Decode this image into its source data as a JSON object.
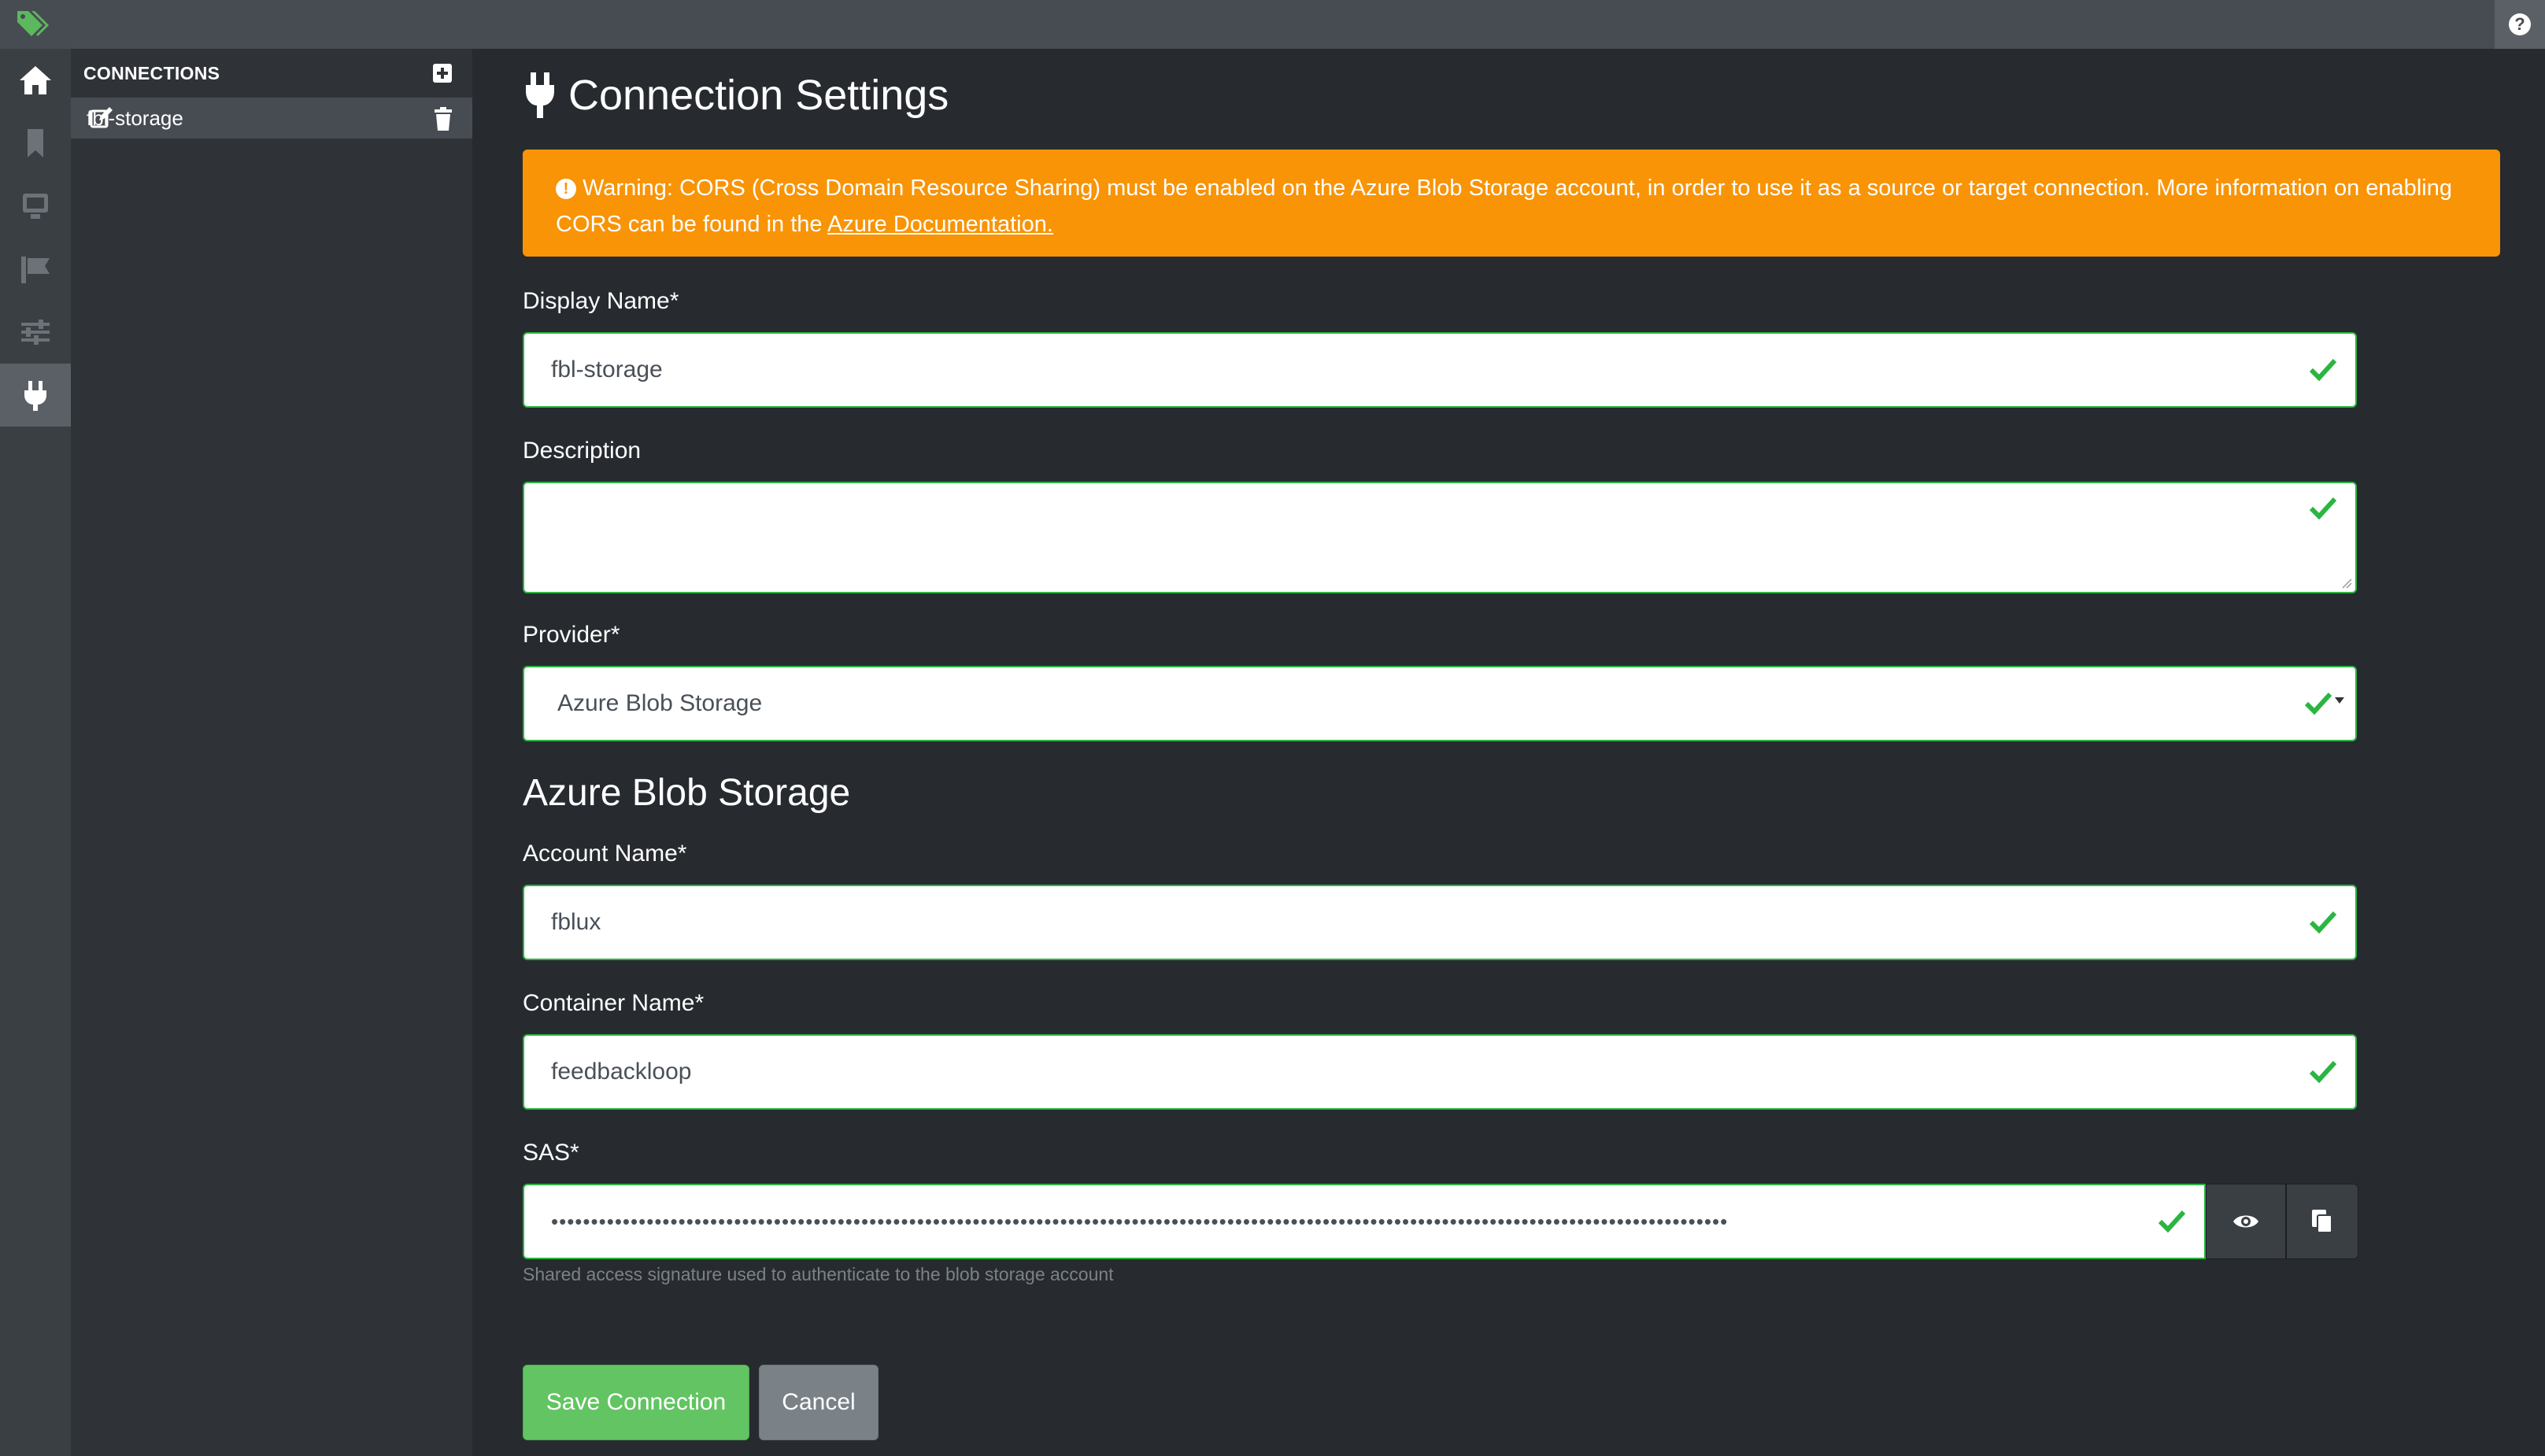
{
  "topbar": {
    "help_label": "?"
  },
  "sidebar": {
    "rail": [
      "home-icon",
      "bookmark-icon",
      "monitor-icon",
      "flag-icon",
      "sliders-icon",
      "plug-icon"
    ],
    "active": "plug-icon"
  },
  "connections": {
    "title": "CONNECTIONS",
    "items": [
      {
        "label": "fbl-storage"
      }
    ]
  },
  "page": {
    "title": "Connection Settings",
    "warning": {
      "text": "Warning: CORS (Cross Domain Resource Sharing) must be enabled on the Azure Blob Storage account, in order to use it as a source or target connection. More information on enabling CORS can be found in the ",
      "link": "Azure Documentation."
    }
  },
  "form": {
    "display_name": {
      "label": "Display Name*",
      "value": "fbl-storage"
    },
    "description": {
      "label": "Description",
      "value": ""
    },
    "provider": {
      "label": "Provider*",
      "value": "Azure Blob Storage"
    },
    "section_title": "Azure Blob Storage",
    "account_name": {
      "label": "Account Name*",
      "value": "fblux"
    },
    "container_name": {
      "label": "Container Name*",
      "value": "feedbackloop"
    },
    "sas": {
      "label": "SAS*",
      "value": "••••••••••••••••••••••••••••••••••••••••••••••••••••••••••••••••••••••••••••••••••••••••••••••••••••••••••••••••••••••••••••••••••••••••••••••••••••",
      "help": "Shared access signature used to authenticate to the blob storage account"
    }
  },
  "actions": {
    "save": "Save Connection",
    "cancel": "Cancel"
  },
  "colors": {
    "accent_green": "#2bb542",
    "warning": "#f89406",
    "bg": "#272b30"
  }
}
